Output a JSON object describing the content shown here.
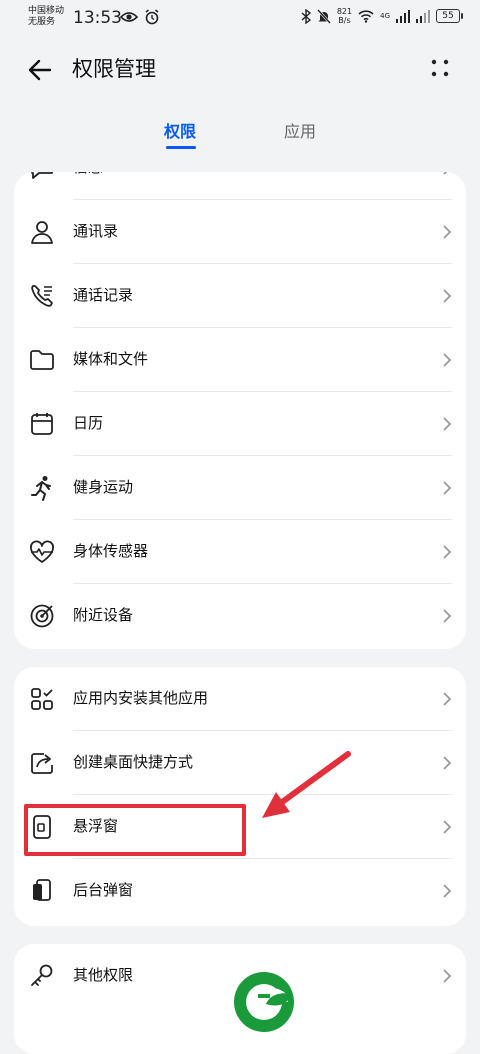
{
  "status_bar": {
    "carrier_line1": "中国移动",
    "carrier_line2": "无服务",
    "time": "13:53",
    "speed_value": "821",
    "speed_unit": "B/s",
    "network": "4G",
    "battery": "55"
  },
  "header": {
    "title": "权限管理"
  },
  "tabs": [
    {
      "label": "权限",
      "active": true
    },
    {
      "label": "应用",
      "active": false
    }
  ],
  "group1": [
    {
      "label": "信息",
      "icon": "message-icon"
    },
    {
      "label": "通讯录",
      "icon": "contacts-icon"
    },
    {
      "label": "通话记录",
      "icon": "call-log-icon"
    },
    {
      "label": "媒体和文件",
      "icon": "folder-icon"
    },
    {
      "label": "日历",
      "icon": "calendar-icon"
    },
    {
      "label": "健身运动",
      "icon": "running-icon"
    },
    {
      "label": "身体传感器",
      "icon": "heart-pulse-icon"
    },
    {
      "label": "附近设备",
      "icon": "nearby-device-icon"
    }
  ],
  "group2": [
    {
      "label": "应用内安装其他应用",
      "icon": "apps-grid-icon"
    },
    {
      "label": "创建桌面快捷方式",
      "icon": "shortcut-icon"
    },
    {
      "label": "悬浮窗",
      "icon": "floating-window-icon"
    },
    {
      "label": "后台弹窗",
      "icon": "background-popup-icon"
    }
  ],
  "group3": [
    {
      "label": "其他权限",
      "icon": "key-icon"
    }
  ],
  "colors": {
    "accent": "#0a59f7",
    "annotation": "#e0303b",
    "logo_green": "#1a9a3a"
  }
}
